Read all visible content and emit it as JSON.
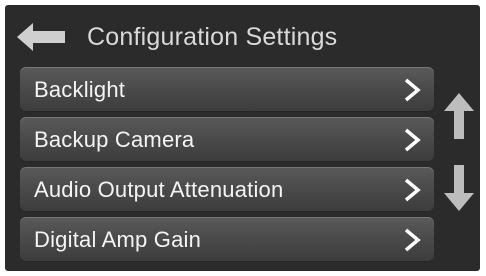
{
  "header": {
    "title": "Configuration Settings",
    "back_icon": "arrow-left-icon"
  },
  "menu": {
    "items": [
      {
        "label": "Backlight",
        "icon": "chevron-right-icon"
      },
      {
        "label": "Backup Camera",
        "icon": "chevron-right-icon"
      },
      {
        "label": "Audio Output Attenuation",
        "icon": "chevron-right-icon"
      },
      {
        "label": "Digital Amp Gain",
        "icon": "chevron-right-icon"
      }
    ]
  },
  "scroll": {
    "up_icon": "arrow-up-icon",
    "down_icon": "arrow-down-icon"
  },
  "colors": {
    "background": "#2b2b2b",
    "item_background": "#4b4b4b",
    "text": "#f4f4f4",
    "icon": "#d9d9d9"
  }
}
